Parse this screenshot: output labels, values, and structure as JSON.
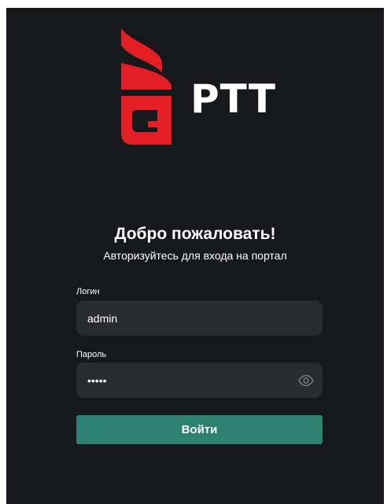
{
  "brand": {
    "logo_text": "PTT",
    "logo_color": "#e31e24"
  },
  "auth": {
    "title": "Добро пожаловать!",
    "subtitle": "Авторизуйтесь для входа на портал",
    "login": {
      "label": "Логин",
      "value": "admin"
    },
    "password": {
      "label": "Пароль",
      "value": "12345",
      "toggle_icon": "eye-icon"
    },
    "submit_label": "Войти"
  },
  "colors": {
    "background": "#17181c",
    "input_bg": "#2a2b30",
    "accent": "#2e8171",
    "text": "#ffffff"
  }
}
